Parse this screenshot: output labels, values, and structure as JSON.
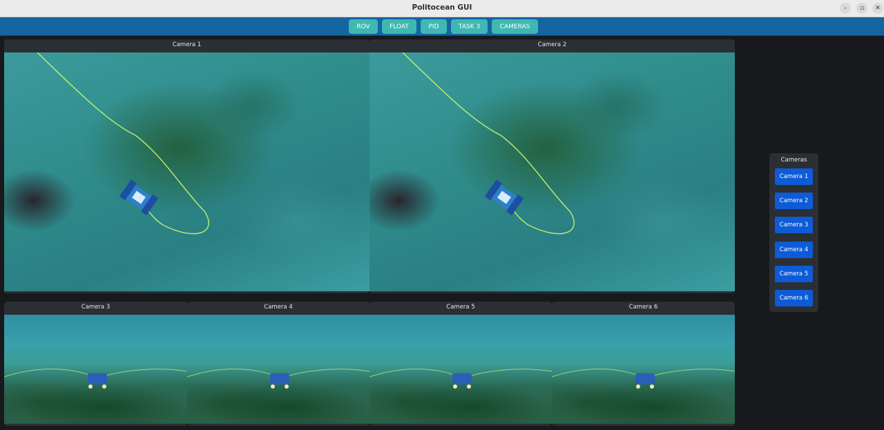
{
  "window": {
    "title": "Politocean GUI"
  },
  "nav": {
    "rov": "ROV",
    "float": "FLOAT",
    "pid": "PID",
    "task3": "TASK 3",
    "cameras": "CAMERAS"
  },
  "feeds": [
    {
      "label": "Camera 1"
    },
    {
      "label": "Camera 2"
    },
    {
      "label": "Camera 3"
    },
    {
      "label": "Camera 4"
    },
    {
      "label": "Camera 5"
    },
    {
      "label": "Camera 6"
    }
  ],
  "sidebar": {
    "title": "Cameras",
    "buttons": [
      "Camera 1",
      "Camera 2",
      "Camera 3",
      "Camera 4",
      "Camera 5",
      "Camera 6"
    ]
  },
  "colors": {
    "nav_bar": "#1565a0",
    "nav_button": "#3fb8b3",
    "camera_button": "#0d5bd7",
    "background": "#17191c",
    "panel": "#2b2e33"
  }
}
